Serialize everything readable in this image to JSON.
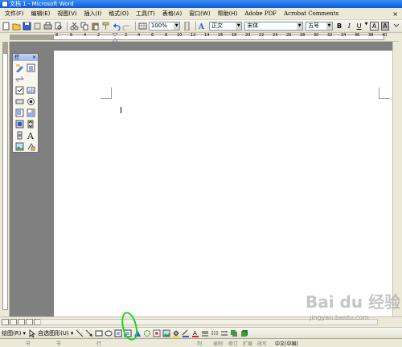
{
  "window": {
    "title": "文档 1 - Microsoft Word"
  },
  "menubar": {
    "items": [
      "文件(F)",
      "编辑(E)",
      "视图(V)",
      "插入(I)",
      "格式(O)",
      "工具(T)",
      "表格(A)",
      "窗口(W)",
      "帮助(H)",
      "Adobe PDF",
      "Acrobat Comments"
    ],
    "close": "×"
  },
  "toolbar": {
    "zoom": "100%",
    "style": "正文",
    "font": "宋体",
    "size": "五号",
    "bold": "B",
    "italic": "I",
    "underline": "U",
    "char_border": "A",
    "char_shading": "A"
  },
  "ruler": {
    "ticks": [
      "8",
      "6",
      "4",
      "2",
      "2",
      "4",
      "6",
      "8",
      "10",
      "12",
      "14",
      "16",
      "18",
      "20",
      "22",
      "24",
      "26",
      "28",
      "30",
      "32",
      "34",
      "36",
      "38",
      "40"
    ]
  },
  "control_toolbox": {
    "title": "控",
    "close": "×"
  },
  "drawing_toolbar": {
    "draw_label": "绘图(R) ▾",
    "autoshapes_label": "自选图形(U) ▾"
  },
  "statusbar": {
    "cells": [
      "节",
      "节",
      "行",
      "列",
      "录制",
      "修订",
      "扩展",
      "改写",
      "中文(中国)"
    ]
  },
  "watermark": {
    "brand": "Bai du 经验",
    "url": "jingyan.baidu.com"
  },
  "colors": {
    "title_bar": "#0a5cd8",
    "highlight_ring": "#1ad61a"
  }
}
